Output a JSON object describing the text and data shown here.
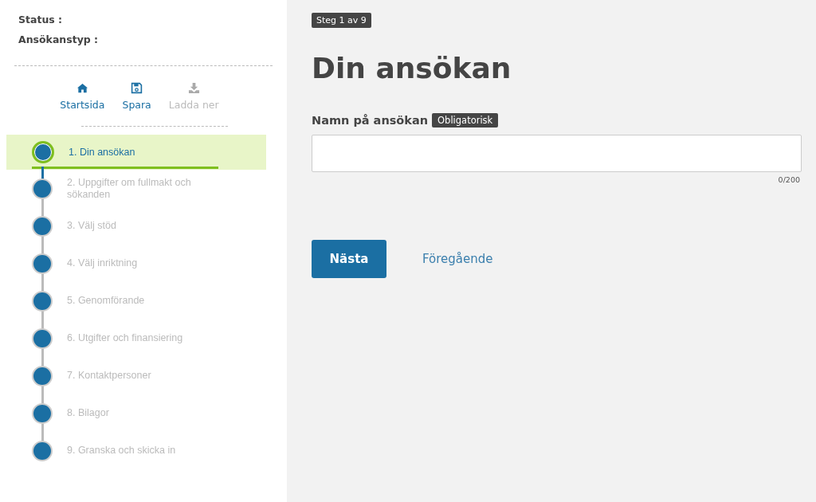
{
  "sidebar": {
    "info": [
      {
        "label": "Status :"
      },
      {
        "label": "Ansökanstyp :"
      }
    ],
    "actions": [
      {
        "kind": "home",
        "label": "Startsida",
        "disabled": false
      },
      {
        "kind": "save",
        "label": "Spara",
        "disabled": false
      },
      {
        "kind": "download",
        "label": "Ladda ner",
        "disabled": true
      }
    ],
    "steps": [
      {
        "label": "1. Din ansökan",
        "selected": true
      },
      {
        "label": "2. Uppgifter om fullmakt och sökanden",
        "selected": false
      },
      {
        "label": "3. Välj stöd",
        "selected": false
      },
      {
        "label": "4. Välj inriktning",
        "selected": false
      },
      {
        "label": "5. Genomförande",
        "selected": false
      },
      {
        "label": "6. Utgifter och finansiering",
        "selected": false
      },
      {
        "label": "7. Kontaktpersoner",
        "selected": false
      },
      {
        "label": "8. Bilagor",
        "selected": false
      },
      {
        "label": "9. Granska och skicka in",
        "selected": false
      }
    ]
  },
  "main": {
    "step_badge": "Steg 1 av 9",
    "title": "Din ansökan",
    "field": {
      "label": "Namn på ansökan",
      "required_badge": "Obligatorisk",
      "counter": "0/200"
    },
    "buttons": [
      {
        "kind": "primary",
        "label": "Nästa"
      },
      {
        "kind": "link",
        "label": "Föregående"
      }
    ]
  }
}
